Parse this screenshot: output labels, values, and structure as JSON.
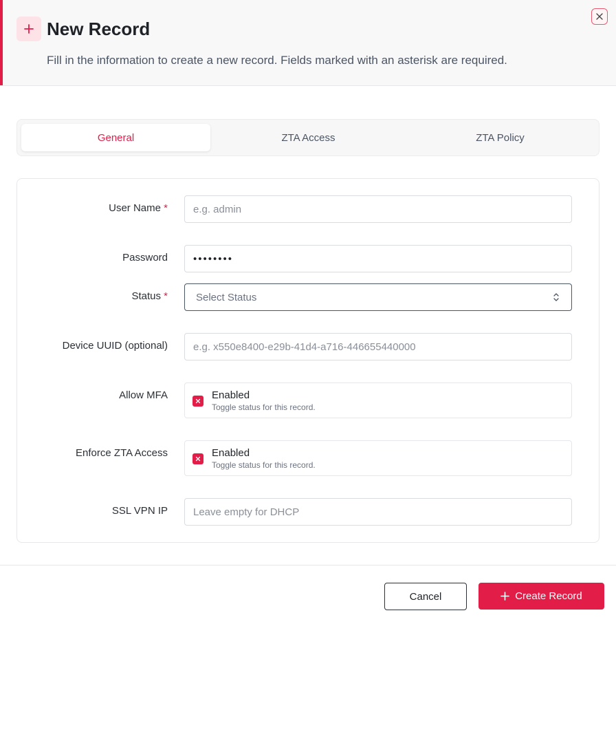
{
  "header": {
    "title": "New Record",
    "subtitle": "Fill in the information to create a new record. Fields marked with an asterisk are required.",
    "accent_color": "#e11d48"
  },
  "tabs": [
    {
      "label": "General",
      "active": true
    },
    {
      "label": "ZTA Access",
      "active": false
    },
    {
      "label": "ZTA Policy",
      "active": false
    }
  ],
  "form": {
    "user_name": {
      "label": "User Name",
      "required_mark": "*",
      "placeholder": "e.g. admin",
      "value": ""
    },
    "password": {
      "label": "Password",
      "value": "••••••••"
    },
    "status": {
      "label": "Status",
      "required_mark": "*",
      "placeholder": "Select Status"
    },
    "device_uuid": {
      "label": "Device UUID (optional)",
      "placeholder": "e.g. x550e8400-e29b-41d4-a716-446655440000",
      "value": ""
    },
    "allow_mfa": {
      "label": "Allow MFA",
      "title": "Enabled",
      "description": "Toggle status for this record."
    },
    "enforce_zta": {
      "label": "Enforce ZTA Access",
      "title": "Enabled",
      "description": "Toggle status for this record."
    },
    "ssl_vpn_ip": {
      "label": "SSL VPN IP",
      "placeholder": "Leave empty for DHCP",
      "value": ""
    }
  },
  "footer": {
    "cancel_label": "Cancel",
    "create_label": "Create Record"
  },
  "icons": {
    "header": "plus-icon",
    "close": "close-icon",
    "select": "chevron-up-down-icon",
    "toggle": "x-icon",
    "create": "plus-icon"
  }
}
